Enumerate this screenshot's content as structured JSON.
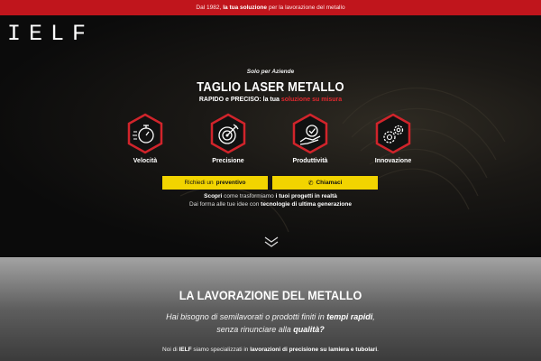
{
  "topbar": {
    "pre": "Dal 1982,",
    "bold": "la tua soluzione",
    "post": "per la lavorazione del metallo"
  },
  "logo": "IELF",
  "hero": {
    "kicker": "Solo per Aziende",
    "title": "TAGLIO LASER METALLO",
    "subtitle_pre": "RAPIDO e PRECISO: la tua",
    "subtitle_red": "soluzione su misura",
    "features": [
      {
        "label": "Velocità",
        "icon": "stopwatch-icon"
      },
      {
        "label": "Precisione",
        "icon": "target-icon"
      },
      {
        "label": "Produttività",
        "icon": "hand-check-icon"
      },
      {
        "label": "Innovazione",
        "icon": "gears-icon"
      }
    ],
    "btn_quote_pre": "Richiedi un",
    "btn_quote_bold": "preventivo",
    "btn_call": "Chiamaci",
    "info_line1_a": "Scopri",
    "info_line1_b": "come trasformiamo",
    "info_line1_c": "i tuoi progetti in realtà",
    "info_line2_a": "Dai forma alle tue idee con",
    "info_line2_b": "tecnologie di ultima generazione"
  },
  "section": {
    "title": "LA LAVORAZIONE DEL METALLO",
    "q1_pre": "Hai bisogno di semilavorati o prodotti finiti in",
    "q1_bold": "tempi rapidi",
    "q1_post": ",",
    "q2_pre": "senza rinunciare alla",
    "q2_bold": "qualità?",
    "body_pre": "Noi di",
    "body_b1": "IELF",
    "body_mid": "siamo specializzati in",
    "body_b2": "lavorazioni di precisione su lamiera e tubolari",
    "body_post": "."
  },
  "colors": {
    "topbar": "#c0151c",
    "accent_red": "#e0292f",
    "button_yellow": "#f2d400"
  }
}
